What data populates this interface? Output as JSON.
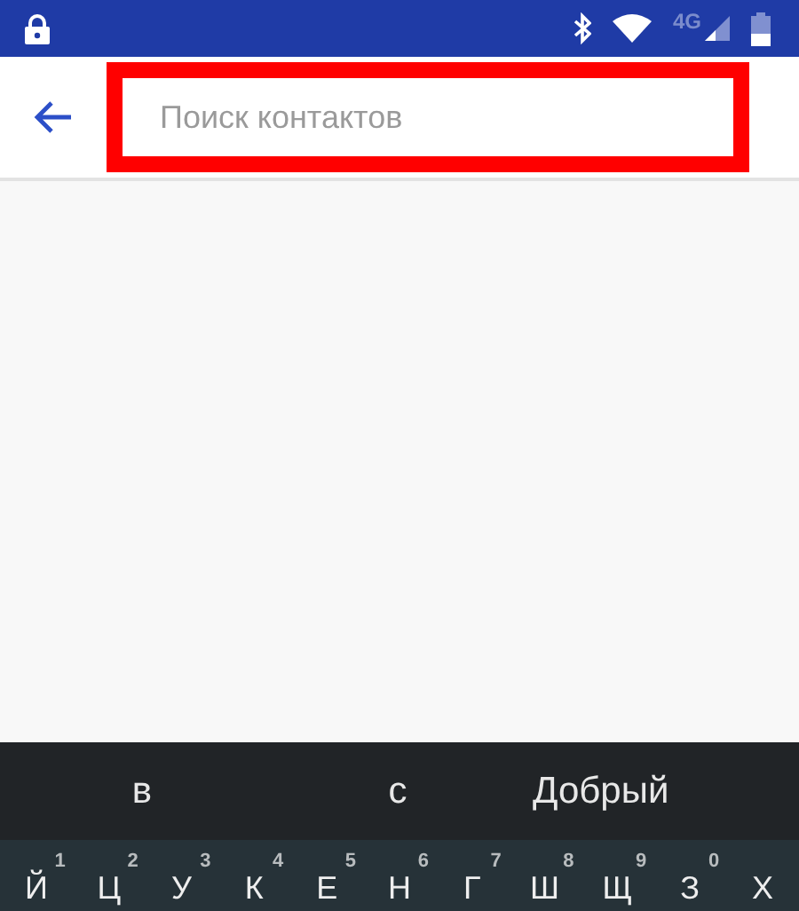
{
  "status_bar": {
    "network": "4G"
  },
  "search": {
    "placeholder": "Поиск контактов",
    "highlighted": true
  },
  "suggestions": [
    {
      "text": "в"
    },
    {
      "text": "с"
    },
    {
      "text": "Добрый"
    }
  ],
  "keys": [
    {
      "hint": "1",
      "letter": "Й"
    },
    {
      "hint": "2",
      "letter": "Ц"
    },
    {
      "hint": "3",
      "letter": "У"
    },
    {
      "hint": "4",
      "letter": "К"
    },
    {
      "hint": "5",
      "letter": "Е"
    },
    {
      "hint": "6",
      "letter": "Н"
    },
    {
      "hint": "7",
      "letter": "Г"
    },
    {
      "hint": "8",
      "letter": "Ш"
    },
    {
      "hint": "9",
      "letter": "Щ"
    },
    {
      "hint": "0",
      "letter": "З"
    },
    {
      "letter": "Х"
    }
  ]
}
